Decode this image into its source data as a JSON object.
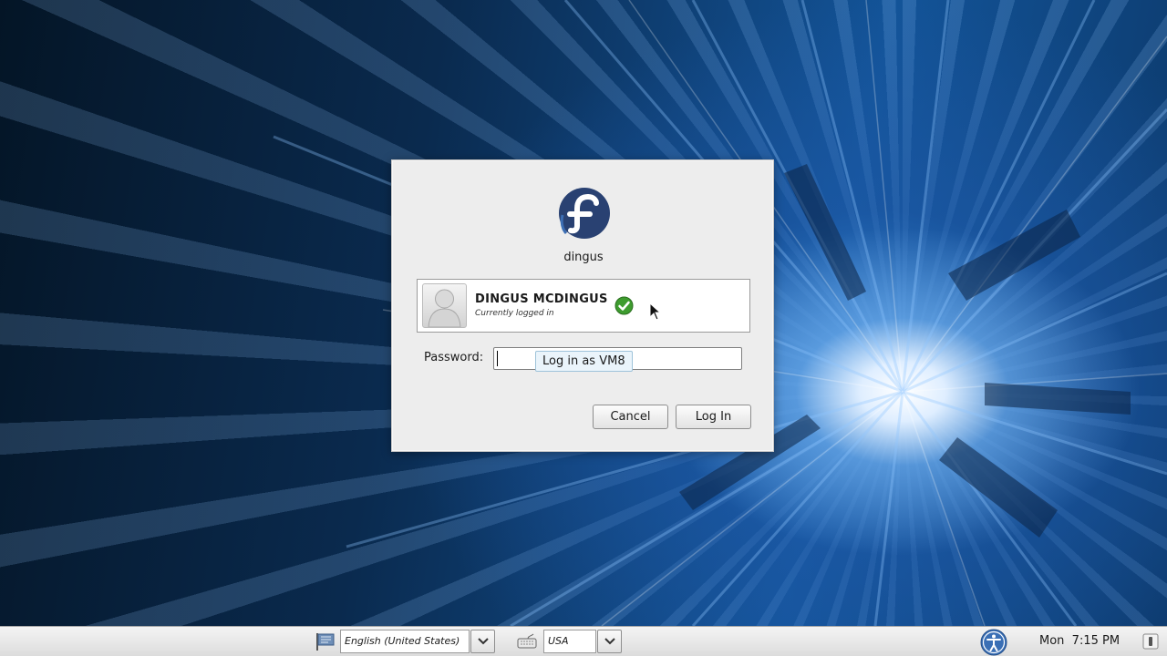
{
  "dialog": {
    "hostname": "dingus",
    "user": {
      "name": "DINGUS MCDINGUS",
      "status": "Currently logged in"
    },
    "password_label": "Password:",
    "tooltip": "Log in as VM8",
    "buttons": {
      "cancel": "Cancel",
      "login": "Log In"
    }
  },
  "panel": {
    "language": "English (United States)",
    "keyboard": "USA",
    "clock": "Mon  7:15 PM"
  },
  "icons": {
    "logo": "fedora-logo-icon",
    "avatar": "user-avatar-icon",
    "logged_in": "checkmark-icon",
    "language": "language-flag-icon",
    "keyboard": "keyboard-icon",
    "accessibility": "accessibility-icon",
    "power": "power-icon"
  },
  "colors": {
    "fedora_blue": "#294172",
    "check_green": "#3e9c2f",
    "accessibility_blue": "#3a6fb5"
  }
}
